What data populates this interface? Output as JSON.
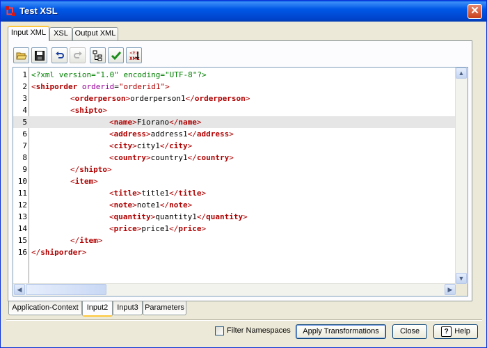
{
  "window": {
    "title": "Test XSL",
    "close_glyph": "✕"
  },
  "top_tabs": [
    {
      "label": "Input XML",
      "active": true
    },
    {
      "label": "XSL",
      "active": false
    },
    {
      "label": "Output XML",
      "active": false
    }
  ],
  "toolbar": {
    "buttons": [
      {
        "icon": "open-folder-icon",
        "enabled": true
      },
      {
        "icon": "save-icon",
        "enabled": true
      },
      {
        "icon": "undo-icon",
        "enabled": true
      },
      {
        "icon": "redo-icon",
        "enabled": false
      },
      {
        "icon": "tree-view-icon",
        "enabled": true
      },
      {
        "icon": "validate-check-icon",
        "enabled": true
      },
      {
        "icon": "xml-transform-icon",
        "enabled": true,
        "label_top": "<E>",
        "label_bottom": "XML"
      }
    ]
  },
  "editor": {
    "highlighted_line": 5,
    "lines": [
      {
        "n": "1",
        "indent": 0,
        "tokens": [
          {
            "t": "pi",
            "v": "<?xml version=\"1.0\" encoding=\"UTF-8\"?>"
          }
        ]
      },
      {
        "n": "2",
        "indent": 0,
        "tokens": [
          {
            "t": "br",
            "v": "<"
          },
          {
            "t": "tag",
            "v": "shiporder"
          },
          {
            "t": "text",
            "v": " "
          },
          {
            "t": "attr",
            "v": "orderid"
          },
          {
            "t": "text",
            "v": "="
          },
          {
            "t": "val",
            "v": "\"orderid1\""
          },
          {
            "t": "br",
            "v": ">"
          }
        ]
      },
      {
        "n": "3",
        "indent": 1,
        "tokens": [
          {
            "t": "br",
            "v": "<"
          },
          {
            "t": "tag",
            "v": "orderperson"
          },
          {
            "t": "br",
            "v": ">"
          },
          {
            "t": "text",
            "v": "orderperson1"
          },
          {
            "t": "br",
            "v": "</"
          },
          {
            "t": "tag",
            "v": "orderperson"
          },
          {
            "t": "br",
            "v": ">"
          }
        ]
      },
      {
        "n": "4",
        "indent": 1,
        "tokens": [
          {
            "t": "br",
            "v": "<"
          },
          {
            "t": "tag",
            "v": "shipto"
          },
          {
            "t": "br",
            "v": ">"
          }
        ]
      },
      {
        "n": "5",
        "indent": 2,
        "tokens": [
          {
            "t": "br",
            "v": "<"
          },
          {
            "t": "tag",
            "v": "name"
          },
          {
            "t": "br",
            "v": ">"
          },
          {
            "t": "text",
            "v": "Fiorano"
          },
          {
            "t": "br",
            "v": "</"
          },
          {
            "t": "tag",
            "v": "name"
          },
          {
            "t": "br",
            "v": ">"
          }
        ]
      },
      {
        "n": "6",
        "indent": 2,
        "tokens": [
          {
            "t": "br",
            "v": "<"
          },
          {
            "t": "tag",
            "v": "address"
          },
          {
            "t": "br",
            "v": ">"
          },
          {
            "t": "text",
            "v": "address1"
          },
          {
            "t": "br",
            "v": "</"
          },
          {
            "t": "tag",
            "v": "address"
          },
          {
            "t": "br",
            "v": ">"
          }
        ]
      },
      {
        "n": "7",
        "indent": 2,
        "tokens": [
          {
            "t": "br",
            "v": "<"
          },
          {
            "t": "tag",
            "v": "city"
          },
          {
            "t": "br",
            "v": ">"
          },
          {
            "t": "text",
            "v": "city1"
          },
          {
            "t": "br",
            "v": "</"
          },
          {
            "t": "tag",
            "v": "city"
          },
          {
            "t": "br",
            "v": ">"
          }
        ]
      },
      {
        "n": "8",
        "indent": 2,
        "tokens": [
          {
            "t": "br",
            "v": "<"
          },
          {
            "t": "tag",
            "v": "country"
          },
          {
            "t": "br",
            "v": ">"
          },
          {
            "t": "text",
            "v": "country1"
          },
          {
            "t": "br",
            "v": "</"
          },
          {
            "t": "tag",
            "v": "country"
          },
          {
            "t": "br",
            "v": ">"
          }
        ]
      },
      {
        "n": "9",
        "indent": 1,
        "tokens": [
          {
            "t": "br",
            "v": "</"
          },
          {
            "t": "tag",
            "v": "shipto"
          },
          {
            "t": "br",
            "v": ">"
          }
        ]
      },
      {
        "n": "10",
        "indent": 1,
        "tokens": [
          {
            "t": "br",
            "v": "<"
          },
          {
            "t": "tag",
            "v": "item"
          },
          {
            "t": "br",
            "v": ">"
          }
        ]
      },
      {
        "n": "11",
        "indent": 2,
        "tokens": [
          {
            "t": "br",
            "v": "<"
          },
          {
            "t": "tag",
            "v": "title"
          },
          {
            "t": "br",
            "v": ">"
          },
          {
            "t": "text",
            "v": "title1"
          },
          {
            "t": "br",
            "v": "</"
          },
          {
            "t": "tag",
            "v": "title"
          },
          {
            "t": "br",
            "v": ">"
          }
        ]
      },
      {
        "n": "12",
        "indent": 2,
        "tokens": [
          {
            "t": "br",
            "v": "<"
          },
          {
            "t": "tag",
            "v": "note"
          },
          {
            "t": "br",
            "v": ">"
          },
          {
            "t": "text",
            "v": "note1"
          },
          {
            "t": "br",
            "v": "</"
          },
          {
            "t": "tag",
            "v": "note"
          },
          {
            "t": "br",
            "v": ">"
          }
        ]
      },
      {
        "n": "13",
        "indent": 2,
        "tokens": [
          {
            "t": "br",
            "v": "<"
          },
          {
            "t": "tag",
            "v": "quantity"
          },
          {
            "t": "br",
            "v": ">"
          },
          {
            "t": "text",
            "v": "quantity1"
          },
          {
            "t": "br",
            "v": "</"
          },
          {
            "t": "tag",
            "v": "quantity"
          },
          {
            "t": "br",
            "v": ">"
          }
        ]
      },
      {
        "n": "14",
        "indent": 2,
        "tokens": [
          {
            "t": "br",
            "v": "<"
          },
          {
            "t": "tag",
            "v": "price"
          },
          {
            "t": "br",
            "v": ">"
          },
          {
            "t": "text",
            "v": "price1"
          },
          {
            "t": "br",
            "v": "</"
          },
          {
            "t": "tag",
            "v": "price"
          },
          {
            "t": "br",
            "v": ">"
          }
        ]
      },
      {
        "n": "15",
        "indent": 1,
        "tokens": [
          {
            "t": "br",
            "v": "</"
          },
          {
            "t": "tag",
            "v": "item"
          },
          {
            "t": "br",
            "v": ">"
          }
        ]
      },
      {
        "n": "16",
        "indent": 0,
        "tokens": [
          {
            "t": "br",
            "v": "</"
          },
          {
            "t": "tag",
            "v": "shiporder"
          },
          {
            "t": "br",
            "v": ">"
          }
        ]
      }
    ],
    "scroll": {
      "up": "▲",
      "down": "▼",
      "left": "◀",
      "right": "▶"
    }
  },
  "bottom_tabs": [
    {
      "label": "Application-Context",
      "active": false
    },
    {
      "label": "Input2",
      "active": true
    },
    {
      "label": "Input3",
      "active": false
    },
    {
      "label": "Parameters",
      "active": false
    }
  ],
  "footer": {
    "filter_namespaces": {
      "label": "Filter Namespaces",
      "checked": false
    },
    "apply_label": "Apply Transformations",
    "close_label": "Close",
    "help_label": "Help",
    "help_glyph": "?"
  }
}
